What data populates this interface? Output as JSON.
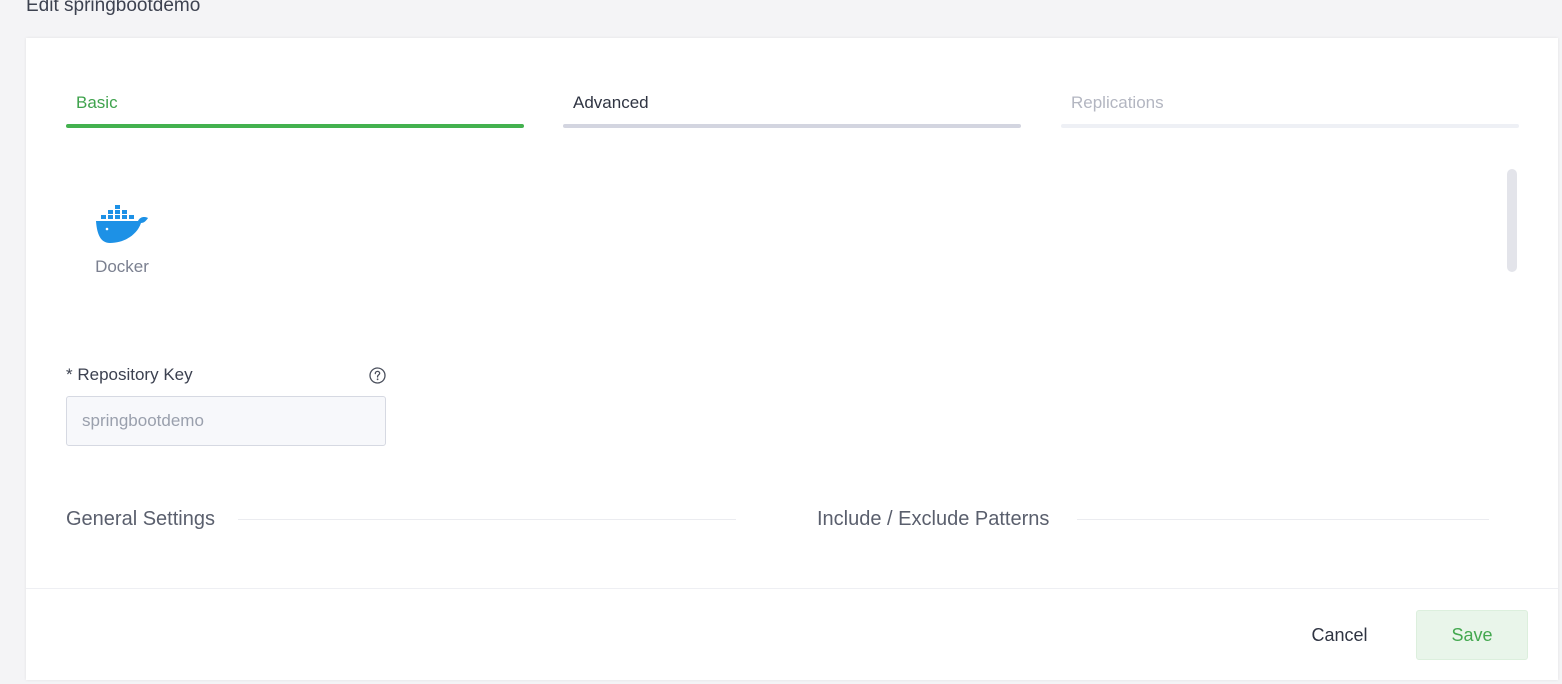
{
  "page": {
    "title": "Edit springbootdemo"
  },
  "tabs": [
    {
      "label": "Basic",
      "state": "active"
    },
    {
      "label": "Advanced",
      "state": "normal"
    },
    {
      "label": "Replications",
      "state": "disabled"
    }
  ],
  "package": {
    "icon": "docker-whale-icon",
    "label": "Docker"
  },
  "repository_key": {
    "label": "* Repository Key",
    "help_icon": "question-circle-icon",
    "placeholder": "springbootdemo"
  },
  "sections": {
    "general": "General Settings",
    "patterns": "Include / Exclude Patterns"
  },
  "footer": {
    "cancel_label": "Cancel",
    "save_label": "Save"
  },
  "colors": {
    "accent_green": "#43b14f",
    "docker_blue": "#1d91e6"
  }
}
